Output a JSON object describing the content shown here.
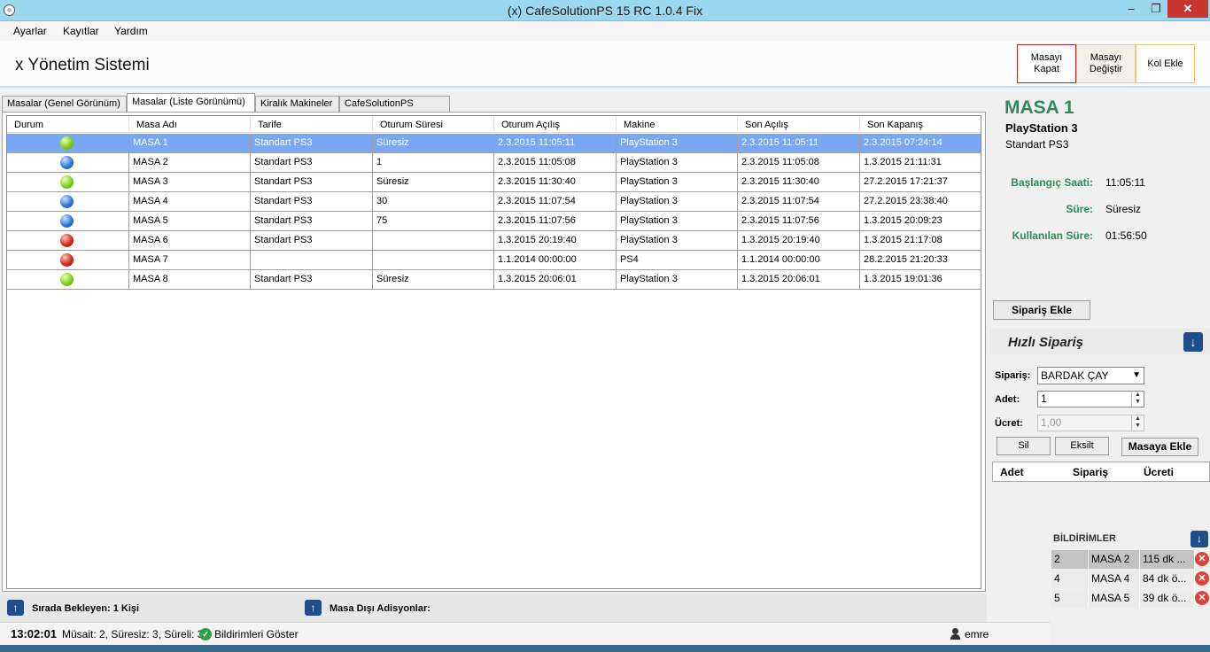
{
  "window": {
    "title": "(x) CafeSolutionPS 15 RC 1.0.4 Fix",
    "min": "‒",
    "max": "❐",
    "close": "✕"
  },
  "menu": [
    "Ayarlar",
    "Kayıtlar",
    "Yardım"
  ],
  "header": {
    "app_title": "x Yönetim Sistemi",
    "buttons": [
      "Masayı Kapat",
      "Masayı Değiştir",
      "Kol Ekle"
    ]
  },
  "tabs": [
    "Masalar (Genel Görünüm)",
    "Masalar (Liste Görünümü)",
    "Kiralık Makineler",
    "CafeSolutionPS Bülteni"
  ],
  "active_tab": 1,
  "grid": {
    "columns": [
      "Durum",
      "Masa Adı",
      "Tarife",
      "Oturum Süresi",
      "Oturum Açılış",
      "Makine",
      "Son Açılış",
      "Son Kapanış"
    ],
    "rows": [
      {
        "status": "green",
        "name": "MASA 1",
        "tarife": "Standart PS3",
        "sure": "Süresiz",
        "acilis": "2.3.2015 11:05:11",
        "makine": "PlayStation 3",
        "son_acilis": "2.3.2015 11:05:11",
        "son_kapanis": "2.3.2015 07:24:14"
      },
      {
        "status": "blue",
        "name": "MASA 2",
        "tarife": "Standart PS3",
        "sure": "1",
        "acilis": "2.3.2015 11:05:08",
        "makine": "PlayStation 3",
        "son_acilis": "2.3.2015 11:05:08",
        "son_kapanis": "1.3.2015 21:11:31"
      },
      {
        "status": "green",
        "name": "MASA 3",
        "tarife": "Standart PS3",
        "sure": "Süresiz",
        "acilis": "2.3.2015 11:30:40",
        "makine": "PlayStation 3",
        "son_acilis": "2.3.2015 11:30:40",
        "son_kapanis": "27.2.2015 17:21:37"
      },
      {
        "status": "blue",
        "name": "MASA 4",
        "tarife": "Standart PS3",
        "sure": "30",
        "acilis": "2.3.2015 11:07:54",
        "makine": "PlayStation 3",
        "son_acilis": "2.3.2015 11:07:54",
        "son_kapanis": "27.2.2015 23:38:40"
      },
      {
        "status": "blue",
        "name": "MASA 5",
        "tarife": "Standart PS3",
        "sure": "75",
        "acilis": "2.3.2015 11:07:56",
        "makine": "PlayStation 3",
        "son_acilis": "2.3.2015 11:07:56",
        "son_kapanis": "1.3.2015 20:09:23"
      },
      {
        "status": "red",
        "name": "MASA 6",
        "tarife": "Standart PS3",
        "sure": "",
        "acilis": "1.3.2015 20:19:40",
        "makine": "PlayStation 3",
        "son_acilis": "1.3.2015 20:19:40",
        "son_kapanis": "1.3.2015 21:17:08"
      },
      {
        "status": "red",
        "name": "MASA 7",
        "tarife": "",
        "sure": "",
        "acilis": "1.1.2014 00:00:00",
        "makine": "PS4",
        "son_acilis": "1.1.2014 00:00:00",
        "son_kapanis": "28.2.2015 21:20:33"
      },
      {
        "status": "green",
        "name": "MASA 8",
        "tarife": "Standart PS3",
        "sure": "Süresiz",
        "acilis": "1.3.2015 20:06:01",
        "makine": "PlayStation 3",
        "son_acilis": "1.3.2015 20:06:01",
        "son_kapanis": "1.3.2015 19:01:36"
      }
    ],
    "selected_row": 0
  },
  "detail": {
    "masa": "MASA 1",
    "machine": "PlayStation 3",
    "tarife": "Standart PS3",
    "baslangic_label": "Başlangıç Saati:",
    "baslangic": "11:05:11",
    "sure_label": "Süre:",
    "sure": "Süresiz",
    "kullanilan_label": "Kullanılan Süre:",
    "kullanilan": "01:56:50"
  },
  "order": {
    "add_button": "Sipariş Ekle",
    "quick_title": "Hızlı Sipariş",
    "siparis_label": "Sipariş:",
    "siparis_value": "BARDAK ÇAY",
    "adet_label": "Adet:",
    "adet_value": "1",
    "ucret_label": "Ücret:",
    "ucret_value": "1,00",
    "sil": "Sil",
    "eksilt": "Eksilt",
    "masaya_ekle": "Masaya Ekle",
    "columns": [
      "Adet",
      "Sipariş",
      "Ücreti"
    ]
  },
  "notifications": {
    "title": "BİLDİRİMLER",
    "rows": [
      {
        "n": "2",
        "masa": "MASA 2",
        "msg": "115 dk ..."
      },
      {
        "n": "4",
        "masa": "MASA 4",
        "msg": "84 dk ö..."
      },
      {
        "n": "5",
        "masa": "MASA 5",
        "msg": "39 dk ö..."
      }
    ]
  },
  "bottom": {
    "queue": "Sırada Bekleyen: 1 Kişi",
    "outside": "Masa Dışı Adisyonlar:"
  },
  "status": {
    "time": "13:02:01",
    "summary": "Müsait: 2, Süresiz: 3, Süreli: 3",
    "show_notifications": "Bildirimleri Göster",
    "user": "emre"
  }
}
